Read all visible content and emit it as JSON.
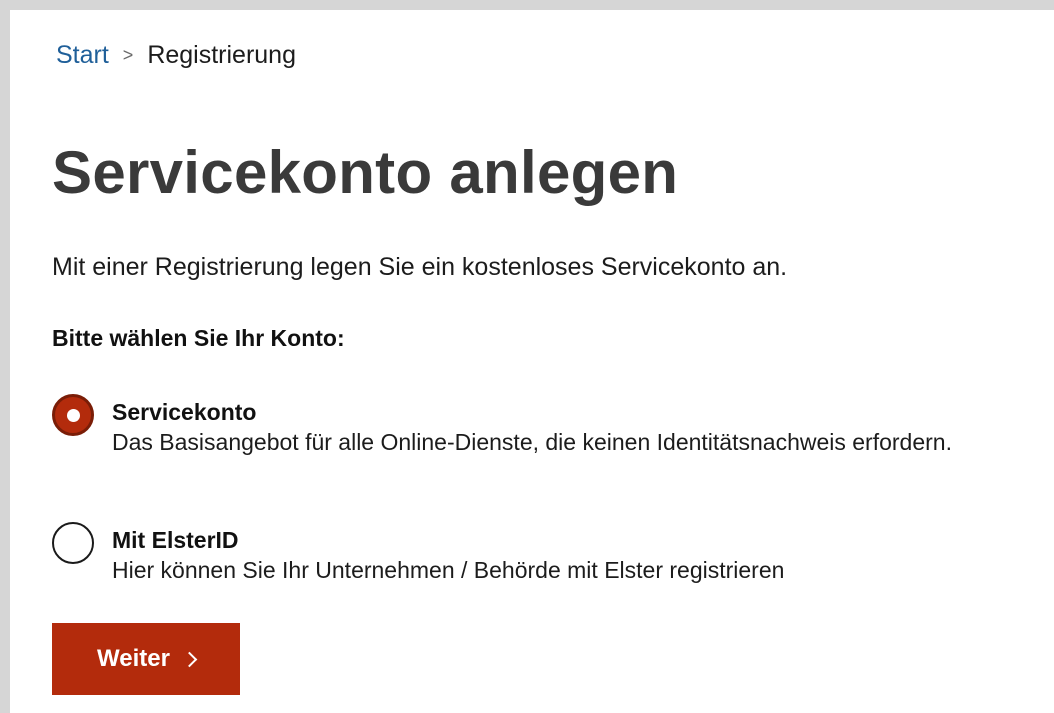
{
  "breadcrumb": {
    "home": "Start",
    "separator": ">",
    "current": "Registrierung"
  },
  "page": {
    "title": "Servicekonto anlegen",
    "intro": "Mit einer Registrierung legen Sie ein kostenloses Servicekonto an.",
    "question": "Bitte wählen Sie Ihr Konto:"
  },
  "options": [
    {
      "title": "Servicekonto",
      "description": "Das Basisangebot für alle Online-Dienste, die keinen Identitätsnachweis erfordern.",
      "selected": true
    },
    {
      "title": "Mit ElsterID",
      "description": "Hier können Sie Ihr Unternehmen / Behörde mit Elster registrieren",
      "selected": false
    }
  ],
  "button": {
    "label": "Weiter",
    "icon": "chevron-right-icon"
  },
  "colors": {
    "accent": "#b32b0c",
    "link": "#1f5f99",
    "title": "#3a3a3a"
  }
}
